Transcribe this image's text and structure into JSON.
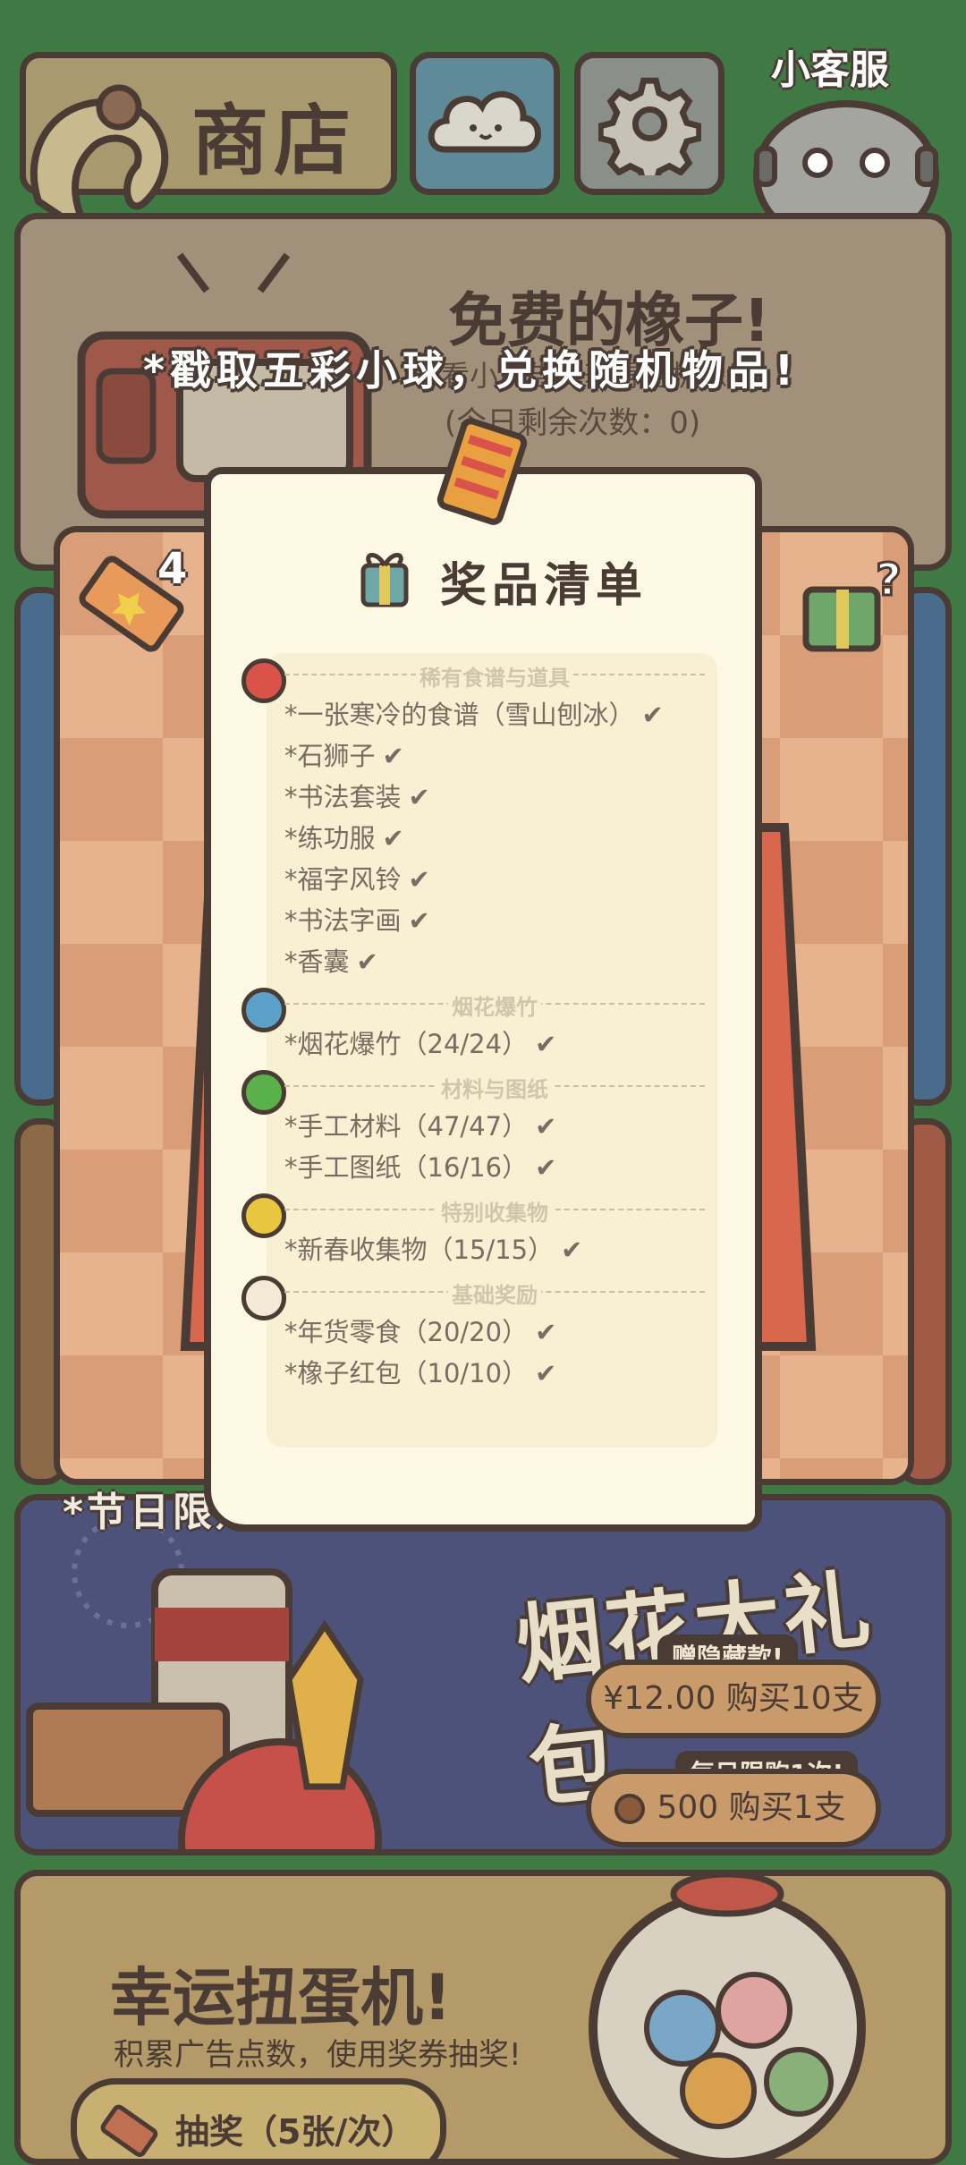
{
  "topbar": {
    "shop_label": "商店",
    "service_label": "小客服"
  },
  "free_card": {
    "title": "免费的橡子!",
    "subtitle": "看小广告，获得随机橡子",
    "remaining": "(今日剩余次数：0)"
  },
  "game": {
    "ticket_count": "4",
    "headline": "*戳取五彩小球，兑换随机物品!"
  },
  "modal": {
    "title": "奖品清单",
    "sections": [
      {
        "name": "稀有食谱与道具",
        "ball_color": "#d9534a",
        "items": [
          "*一张寒冷的食谱（雪山刨冰）",
          "*石狮子",
          "*书法套装",
          "*练功服",
          "*福字风铃",
          "*书法字画",
          "*香囊"
        ]
      },
      {
        "name": "烟花爆竹",
        "ball_color": "#5aa0c8",
        "items": [
          "*烟花爆竹（24/24）"
        ]
      },
      {
        "name": "材料与图纸",
        "ball_color": "#5ab04a",
        "items": [
          "*手工材料（47/47）",
          "*手工图纸（16/16）"
        ]
      },
      {
        "name": "特别收集物",
        "ball_color": "#e8c640",
        "items": [
          "*新春收集物（15/15）"
        ]
      },
      {
        "name": "基础奖励",
        "ball_color": "#f2ead6",
        "items": [
          "*年货零食（20/20）",
          "*橡子红包（10/10）"
        ]
      }
    ],
    "check_glyph": "✔"
  },
  "limited": {
    "label": "*节日限定"
  },
  "fireworks": {
    "title": "烟花大礼包",
    "tag1": "赠隐藏款!",
    "price1": "¥12.00 购买10支",
    "tag2": "每日限购1次!",
    "price2": "500 购买1支"
  },
  "lucky": {
    "title": "幸运扭蛋机!",
    "subtitle": "积累广告点数，使用奖券抽奖!",
    "button": "抽奖（5张/次）"
  }
}
